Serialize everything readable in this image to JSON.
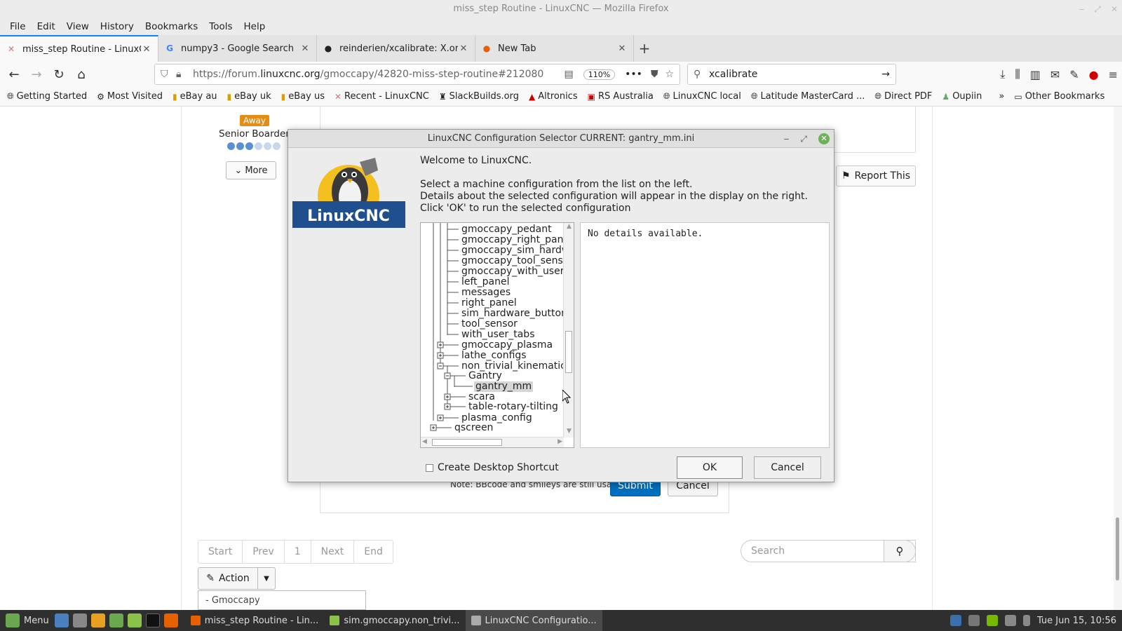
{
  "window": {
    "title": "miss_step Routine - LinuxCNC — Mozilla Firefox"
  },
  "menubar": [
    "File",
    "Edit",
    "View",
    "History",
    "Bookmarks",
    "Tools",
    "Help"
  ],
  "tabs": [
    {
      "label": "miss_step Routine - LinuxCNC",
      "active": true
    },
    {
      "label": "numpy3 - Google Search",
      "active": false
    },
    {
      "label": "reinderien/xcalibrate: X.org",
      "active": false
    },
    {
      "label": "New Tab",
      "active": false
    }
  ],
  "navbar": {
    "url_prefix": "https://forum.",
    "url_host": "linuxcnc.org",
    "url_path": "/gmoccapy/42820-miss-step-routine#212080",
    "zoom": "110%",
    "search_value": "xcalibrate"
  },
  "bookmarks": [
    "Getting Started",
    "Most Visited",
    "eBay au",
    "eBay uk",
    "eBay us",
    "Recent - LinuxCNC",
    "SlackBuilds.org",
    "Altronics",
    "RS Australia",
    "LinuxCNC local",
    "Latitude MasterCard ...",
    "Direct PDF",
    "Oupiin"
  ],
  "bookmarks_other": "Other Bookmarks",
  "page": {
    "status_badge": "Away",
    "rank": "Senior Boarder",
    "more_label": "More",
    "report_label": "Report This",
    "note": "Note: BBcode and smileys are still usable.",
    "submit_label": "Submit",
    "cancel_label": "Cancel",
    "pager": [
      "Start",
      "Prev",
      "1",
      "Next",
      "End"
    ],
    "search_placeholder": "Search",
    "action_label": "Action",
    "category_select": "- Gmoccapy"
  },
  "dialog": {
    "title": "LinuxCNC Configuration Selector CURRENT: gantry_mm.ini",
    "logo_text": "LinuxCNC",
    "welcome": "Welcome to LinuxCNC.",
    "instructions": [
      "Select a machine configuration from the list on the left.",
      "Details about the selected configuration will appear in the display on the right.",
      "Click 'OK' to run the selected configuration"
    ],
    "tree": [
      "gmoccapy_pedant",
      "gmoccapy_right_pane",
      "gmoccapy_sim_hardw",
      "gmoccapy_tool_senso",
      "gmoccapy_with_user_",
      "left_panel",
      "messages",
      "right_panel",
      "sim_hardware_button",
      "tool_sensor",
      "with_user_tabs",
      "gmoccapy_plasma",
      "lathe_configs",
      "non_trivial_kinematics",
      "Gantry",
      "gantry_mm",
      "scara",
      "table-rotary-tilting",
      "plasma_config",
      "qscreen"
    ],
    "details": "No details available.",
    "shortcut_label": "Create Desktop Shortcut",
    "ok_label": "OK",
    "cancel_label": "Cancel"
  },
  "taskbar": {
    "menu_label": "Menu",
    "tasks": [
      {
        "label": "miss_step Routine - Lin...",
        "active": false
      },
      {
        "label": "sim.gmoccapy.non_trivi...",
        "active": false
      },
      {
        "label": "LinuxCNC Configuratio...",
        "active": true
      }
    ],
    "clock": "Tue Jun 15, 10:56"
  },
  "colors": {
    "accent_blue": "#0a84ff",
    "submit_blue": "#0070c0",
    "away_badge": "#e48c14",
    "taskbar_bg": "#2f2f2f"
  }
}
